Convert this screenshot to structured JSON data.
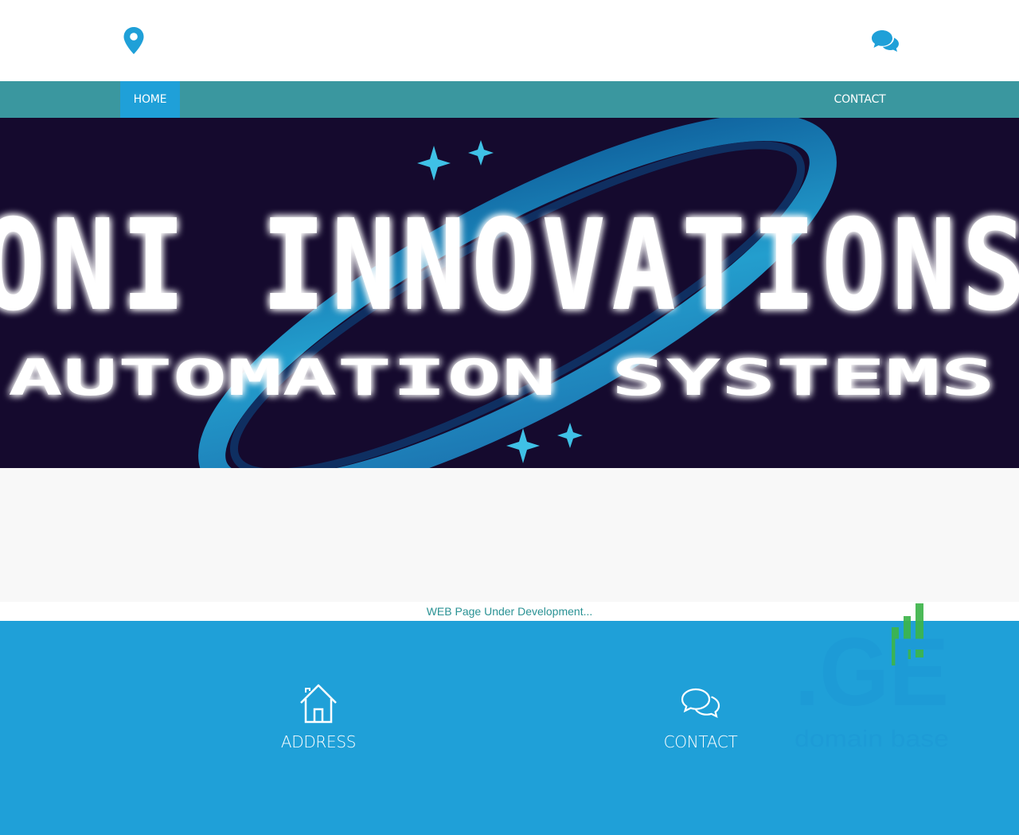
{
  "header": {
    "location_icon": "map-marker-icon",
    "chat_icon": "chat-bubbles-icon",
    "icon_color": "#1fa0d8"
  },
  "nav": {
    "home_label": "HOME",
    "contact_label": "CONTACT",
    "bar_color": "#3a979f",
    "active_color": "#1fa0d8"
  },
  "banner": {
    "title": "ONI INNOVATIONS",
    "subtitle": "AUTOMATION SYSTEMS",
    "background": "#150a2e",
    "accent": "#1e88c8"
  },
  "notice": {
    "text": "WEB Page Under Development..."
  },
  "footer": {
    "address_label": "ADDRESS",
    "address_icon": "home-icon",
    "contact_label": "CONTACT",
    "contact_icon": "chat-bubbles-icon",
    "background": "#1fa0d8"
  },
  "badge": {
    "logo_text": ".GE",
    "logo_subtext": "domain base",
    "bars_color": "#3db54a"
  }
}
